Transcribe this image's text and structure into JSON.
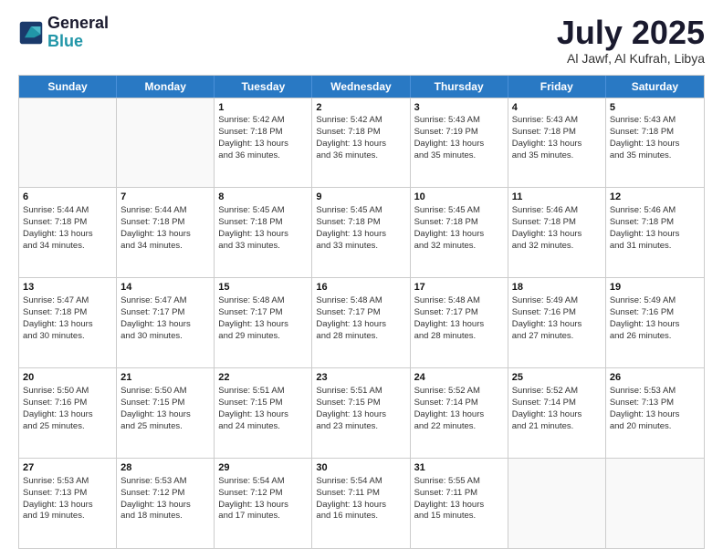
{
  "header": {
    "logo_line1": "General",
    "logo_line2": "Blue",
    "month_year": "July 2025",
    "location": "Al Jawf, Al Kufrah, Libya"
  },
  "days_of_week": [
    "Sunday",
    "Monday",
    "Tuesday",
    "Wednesday",
    "Thursday",
    "Friday",
    "Saturday"
  ],
  "weeks": [
    [
      {
        "day": "",
        "info": "",
        "empty": true
      },
      {
        "day": "",
        "info": "",
        "empty": true
      },
      {
        "day": "1",
        "info": "Sunrise: 5:42 AM\nSunset: 7:18 PM\nDaylight: 13 hours\nand 36 minutes.",
        "empty": false
      },
      {
        "day": "2",
        "info": "Sunrise: 5:42 AM\nSunset: 7:18 PM\nDaylight: 13 hours\nand 36 minutes.",
        "empty": false
      },
      {
        "day": "3",
        "info": "Sunrise: 5:43 AM\nSunset: 7:19 PM\nDaylight: 13 hours\nand 35 minutes.",
        "empty": false
      },
      {
        "day": "4",
        "info": "Sunrise: 5:43 AM\nSunset: 7:18 PM\nDaylight: 13 hours\nand 35 minutes.",
        "empty": false
      },
      {
        "day": "5",
        "info": "Sunrise: 5:43 AM\nSunset: 7:18 PM\nDaylight: 13 hours\nand 35 minutes.",
        "empty": false
      }
    ],
    [
      {
        "day": "6",
        "info": "Sunrise: 5:44 AM\nSunset: 7:18 PM\nDaylight: 13 hours\nand 34 minutes.",
        "empty": false
      },
      {
        "day": "7",
        "info": "Sunrise: 5:44 AM\nSunset: 7:18 PM\nDaylight: 13 hours\nand 34 minutes.",
        "empty": false
      },
      {
        "day": "8",
        "info": "Sunrise: 5:45 AM\nSunset: 7:18 PM\nDaylight: 13 hours\nand 33 minutes.",
        "empty": false
      },
      {
        "day": "9",
        "info": "Sunrise: 5:45 AM\nSunset: 7:18 PM\nDaylight: 13 hours\nand 33 minutes.",
        "empty": false
      },
      {
        "day": "10",
        "info": "Sunrise: 5:45 AM\nSunset: 7:18 PM\nDaylight: 13 hours\nand 32 minutes.",
        "empty": false
      },
      {
        "day": "11",
        "info": "Sunrise: 5:46 AM\nSunset: 7:18 PM\nDaylight: 13 hours\nand 32 minutes.",
        "empty": false
      },
      {
        "day": "12",
        "info": "Sunrise: 5:46 AM\nSunset: 7:18 PM\nDaylight: 13 hours\nand 31 minutes.",
        "empty": false
      }
    ],
    [
      {
        "day": "13",
        "info": "Sunrise: 5:47 AM\nSunset: 7:18 PM\nDaylight: 13 hours\nand 30 minutes.",
        "empty": false
      },
      {
        "day": "14",
        "info": "Sunrise: 5:47 AM\nSunset: 7:17 PM\nDaylight: 13 hours\nand 30 minutes.",
        "empty": false
      },
      {
        "day": "15",
        "info": "Sunrise: 5:48 AM\nSunset: 7:17 PM\nDaylight: 13 hours\nand 29 minutes.",
        "empty": false
      },
      {
        "day": "16",
        "info": "Sunrise: 5:48 AM\nSunset: 7:17 PM\nDaylight: 13 hours\nand 28 minutes.",
        "empty": false
      },
      {
        "day": "17",
        "info": "Sunrise: 5:48 AM\nSunset: 7:17 PM\nDaylight: 13 hours\nand 28 minutes.",
        "empty": false
      },
      {
        "day": "18",
        "info": "Sunrise: 5:49 AM\nSunset: 7:16 PM\nDaylight: 13 hours\nand 27 minutes.",
        "empty": false
      },
      {
        "day": "19",
        "info": "Sunrise: 5:49 AM\nSunset: 7:16 PM\nDaylight: 13 hours\nand 26 minutes.",
        "empty": false
      }
    ],
    [
      {
        "day": "20",
        "info": "Sunrise: 5:50 AM\nSunset: 7:16 PM\nDaylight: 13 hours\nand 25 minutes.",
        "empty": false
      },
      {
        "day": "21",
        "info": "Sunrise: 5:50 AM\nSunset: 7:15 PM\nDaylight: 13 hours\nand 25 minutes.",
        "empty": false
      },
      {
        "day": "22",
        "info": "Sunrise: 5:51 AM\nSunset: 7:15 PM\nDaylight: 13 hours\nand 24 minutes.",
        "empty": false
      },
      {
        "day": "23",
        "info": "Sunrise: 5:51 AM\nSunset: 7:15 PM\nDaylight: 13 hours\nand 23 minutes.",
        "empty": false
      },
      {
        "day": "24",
        "info": "Sunrise: 5:52 AM\nSunset: 7:14 PM\nDaylight: 13 hours\nand 22 minutes.",
        "empty": false
      },
      {
        "day": "25",
        "info": "Sunrise: 5:52 AM\nSunset: 7:14 PM\nDaylight: 13 hours\nand 21 minutes.",
        "empty": false
      },
      {
        "day": "26",
        "info": "Sunrise: 5:53 AM\nSunset: 7:13 PM\nDaylight: 13 hours\nand 20 minutes.",
        "empty": false
      }
    ],
    [
      {
        "day": "27",
        "info": "Sunrise: 5:53 AM\nSunset: 7:13 PM\nDaylight: 13 hours\nand 19 minutes.",
        "empty": false
      },
      {
        "day": "28",
        "info": "Sunrise: 5:53 AM\nSunset: 7:12 PM\nDaylight: 13 hours\nand 18 minutes.",
        "empty": false
      },
      {
        "day": "29",
        "info": "Sunrise: 5:54 AM\nSunset: 7:12 PM\nDaylight: 13 hours\nand 17 minutes.",
        "empty": false
      },
      {
        "day": "30",
        "info": "Sunrise: 5:54 AM\nSunset: 7:11 PM\nDaylight: 13 hours\nand 16 minutes.",
        "empty": false
      },
      {
        "day": "31",
        "info": "Sunrise: 5:55 AM\nSunset: 7:11 PM\nDaylight: 13 hours\nand 15 minutes.",
        "empty": false
      },
      {
        "day": "",
        "info": "",
        "empty": true
      },
      {
        "day": "",
        "info": "",
        "empty": true
      }
    ]
  ]
}
